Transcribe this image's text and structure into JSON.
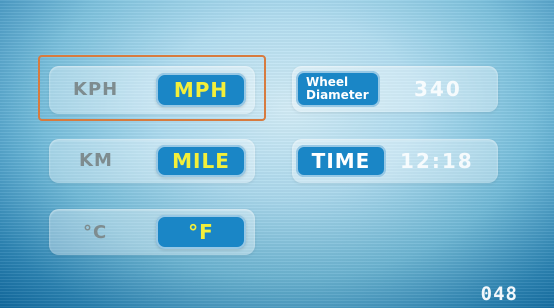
{
  "settings": {
    "speed_unit": {
      "options": [
        "KPH",
        "MPH"
      ],
      "selected": "MPH"
    },
    "distance_unit": {
      "options": [
        "KM",
        "MILE"
      ],
      "selected": "MILE"
    },
    "temperature_unit": {
      "options": [
        "°C",
        "°F"
      ],
      "selected": "°F"
    }
  },
  "wheel": {
    "label_line1": "Wheel",
    "label_line2": "Diameter",
    "value": "340"
  },
  "time": {
    "label": "TIME",
    "value": "12:18"
  },
  "counter": "048",
  "colors": {
    "accent": "#1a86c6",
    "selected_text": "#f3ef3a",
    "focus_frame": "#d77b3f"
  }
}
